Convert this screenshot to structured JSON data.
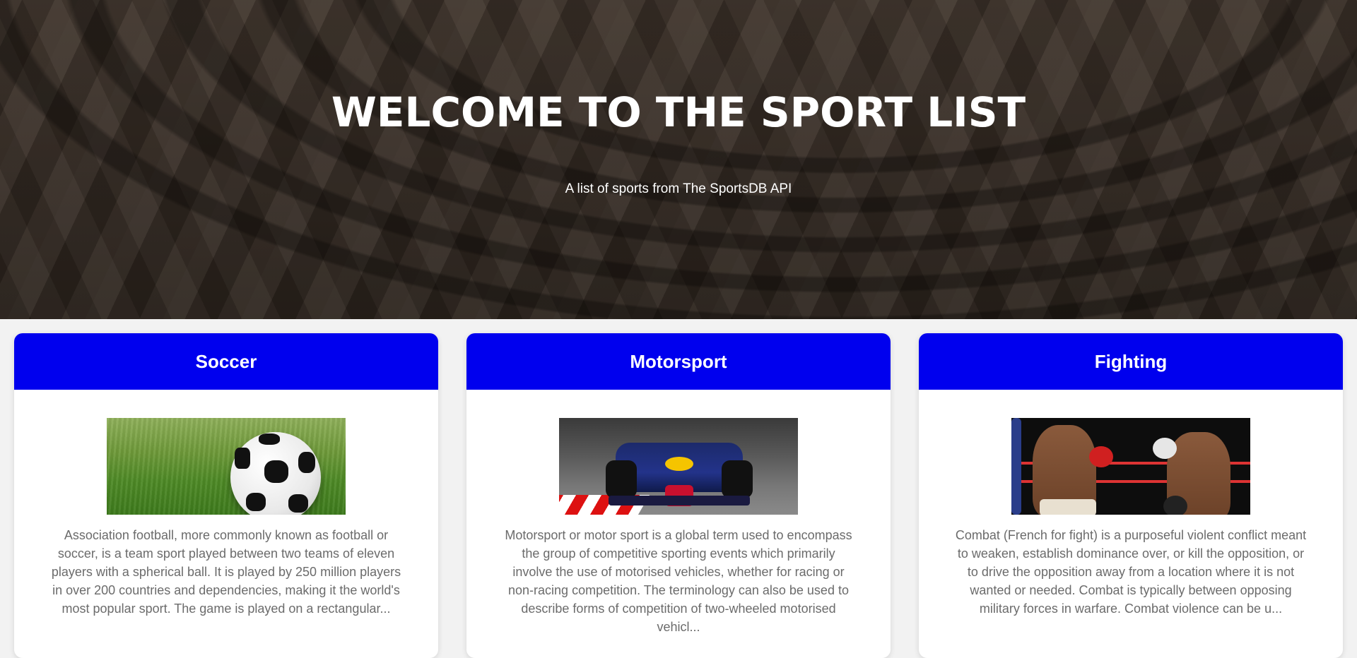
{
  "hero": {
    "title": "WELCOME TO THE SPORT LIST",
    "subtitle": "A list of sports from The SportsDB API"
  },
  "colors": {
    "card_header": "#0000ee",
    "description_text": "#6b6b6b",
    "page_background": "#f2f2f2"
  },
  "cards": [
    {
      "title": "Soccer",
      "image": "soccer-ball-on-grass",
      "description": "Association football, more commonly known as football or soccer, is a team sport played between two teams of eleven players with a spherical ball. It is played by 250 million players in over 200 countries and dependencies, making it the world's most popular sport. The game is played on a rectangular..."
    },
    {
      "title": "Motorsport",
      "image": "formula-one-race-car",
      "description": "Motorsport or motor sport is a global term used to encompass the group of competitive sporting events which primarily involve the use of motorised vehicles, whether for racing or non-racing competition. The terminology can also be used to describe forms of competition of two-wheeled motorised vehicl..."
    },
    {
      "title": "Fighting",
      "image": "boxers-in-ring",
      "description": "Combat (French for fight) is a purposeful violent conflict meant to weaken, establish dominance over, or kill the opposition, or to drive the opposition away from a location where it is not wanted or needed. Combat is typically between opposing military forces in warfare. Combat violence can be u..."
    }
  ]
}
